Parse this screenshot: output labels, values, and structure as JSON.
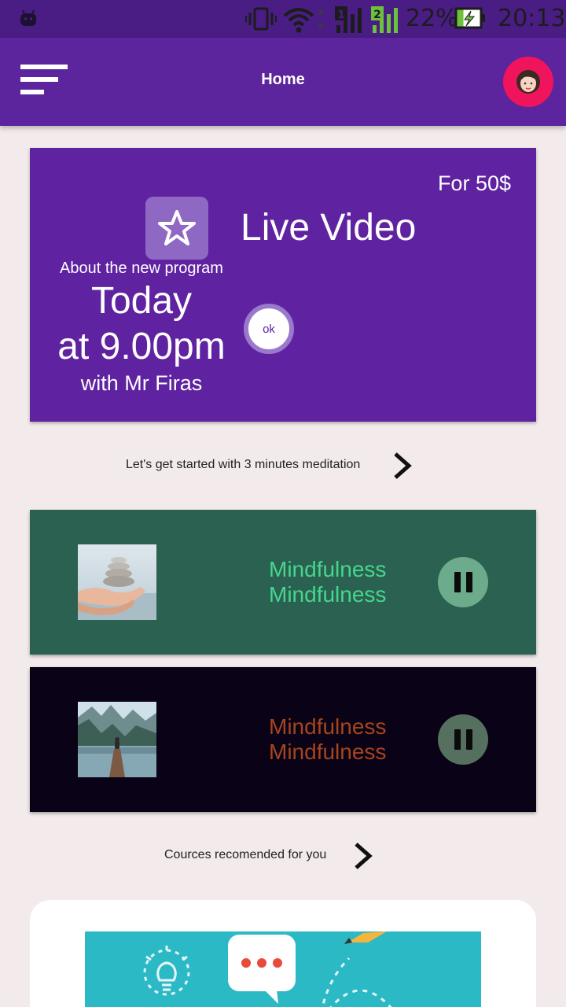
{
  "status_bar": {
    "battery": "22%",
    "time": "20:13",
    "sim1": "1",
    "sim2": "2"
  },
  "app_bar": {
    "title": "Home"
  },
  "live_card": {
    "price": "For 50$",
    "title": "Live Video",
    "about": "About the new program",
    "day": "Today",
    "time": "at 9.00pm",
    "host": "with Mr Firas",
    "ok_label": "ok"
  },
  "meditation_section": {
    "label": "Let's get started with 3 minutes meditation"
  },
  "tracks": [
    {
      "line1": "Mindfulness",
      "line2": "Mindfulness",
      "background": "#2b6150",
      "text_color": "#46d68f",
      "button_color": "#6cab8b"
    },
    {
      "line1": "Mindfulness",
      "line2": "Mindfulness",
      "background": "#0a0217",
      "text_color": "#a7451c",
      "button_color": "#55705f"
    }
  ],
  "courses_section": {
    "label": "Cources recomended for you"
  },
  "colors": {
    "primary": "#5f22a0",
    "status_bar": "#4a1d84",
    "avatar_bg": "#f0145c",
    "background": "#f3ebeb"
  },
  "icons": [
    "android-icon",
    "vibrate-icon",
    "wifi-icon",
    "signal-icon",
    "battery-charging-icon",
    "menu-icon",
    "avatar-icon",
    "star-icon",
    "chevron-right-icon",
    "pause-icon",
    "lightbulb-icon",
    "chat-bubble-icon",
    "pencil-icon"
  ]
}
